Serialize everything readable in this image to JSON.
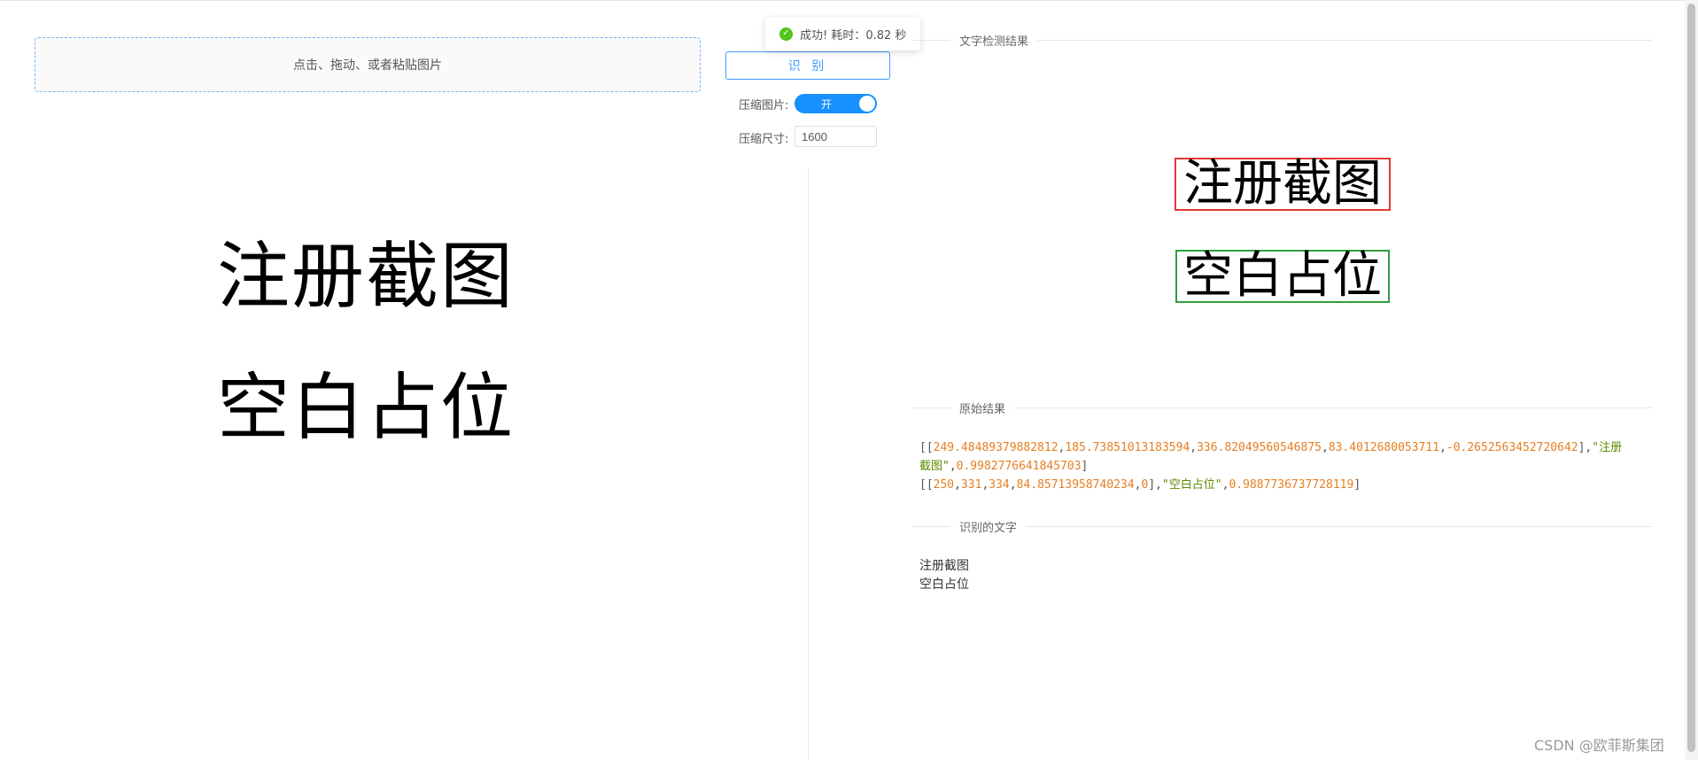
{
  "upload": {
    "prompt": "点击、拖动、或者粘贴图片"
  },
  "controls": {
    "recognize_label": "识 别",
    "compress_label": "压缩图片:",
    "compress_switch_text": "开",
    "compress_enabled": true,
    "size_label": "压缩尺寸:",
    "size_value": "1600"
  },
  "toast": {
    "icon": "check-circle-icon",
    "message": "成功! 耗时：0.82 秒"
  },
  "preview": {
    "lines": [
      "注册截图",
      "空白占位"
    ]
  },
  "sections": {
    "detection_title": "文字检测结果",
    "raw_title": "原始结果",
    "text_title": "识别的文字"
  },
  "detection": {
    "boxes": [
      {
        "text": "注册截图",
        "color": "#e53935"
      },
      {
        "text": "空白占位",
        "color": "#2e9e3e"
      }
    ]
  },
  "raw_results": [
    {
      "box": [
        "249.48489379882812",
        "185.73851013183594",
        "336.82049560546875",
        "83.4012680053711",
        "-0.2652563452720642"
      ],
      "text": "\"注册截图\"",
      "score": "0.9982776641845703"
    },
    {
      "box": [
        "250",
        "331",
        "334",
        "84.85713958740234",
        "0"
      ],
      "text": "\"空白占位\"",
      "score": "0.9887736737728119"
    }
  ],
  "recognized_text": [
    "注册截图",
    "空白占位"
  ],
  "watermark": "CSDN @欧菲斯集团",
  "colors": {
    "accent": "#409eff",
    "switch_on": "#1890ff",
    "number": "#e67e22",
    "string": "#5a8a00",
    "success": "#52c41a"
  }
}
